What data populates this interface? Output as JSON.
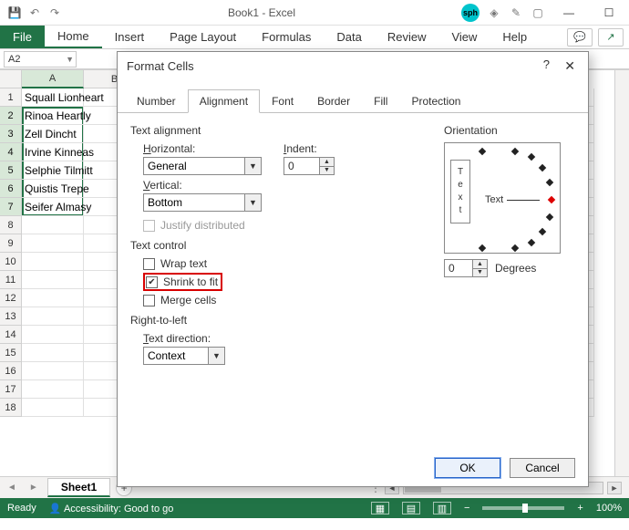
{
  "titlebar": {
    "title": "Book1 - Excel"
  },
  "ribbon": {
    "file": "File",
    "tabs": [
      "Home",
      "Insert",
      "Page Layout",
      "Formulas",
      "Data",
      "Review",
      "View",
      "Help"
    ]
  },
  "namebox": {
    "value": "A2"
  },
  "grid": {
    "col_headers": [
      "A",
      "B"
    ],
    "rows": [
      {
        "n": 1,
        "a": "Squall Lionheart"
      },
      {
        "n": 2,
        "a": "Rinoa Heartly"
      },
      {
        "n": 3,
        "a": "Zell Dincht"
      },
      {
        "n": 4,
        "a": "Irvine Kinneas"
      },
      {
        "n": 5,
        "a": "Selphie Tilmitt"
      },
      {
        "n": 6,
        "a": "Quistis Trepe"
      },
      {
        "n": 7,
        "a": "Seifer Almasy"
      },
      {
        "n": 8,
        "a": ""
      },
      {
        "n": 9,
        "a": ""
      },
      {
        "n": 10,
        "a": ""
      },
      {
        "n": 11,
        "a": ""
      },
      {
        "n": 12,
        "a": ""
      },
      {
        "n": 13,
        "a": ""
      },
      {
        "n": 14,
        "a": ""
      },
      {
        "n": 15,
        "a": ""
      },
      {
        "n": 16,
        "a": ""
      },
      {
        "n": 17,
        "a": ""
      },
      {
        "n": 18,
        "a": ""
      }
    ]
  },
  "sheets": {
    "active": "Sheet1"
  },
  "status": {
    "mode": "Ready",
    "accessibility": "Accessibility: Good to go",
    "zoom": "100%"
  },
  "dialog": {
    "title": "Format Cells",
    "tabs": [
      "Number",
      "Alignment",
      "Font",
      "Border",
      "Fill",
      "Protection"
    ],
    "active_tab": "Alignment",
    "sections": {
      "text_alignment": "Text alignment",
      "horizontal_label": "Horizontal:",
      "horizontal_value": "General",
      "vertical_label": "Vertical:",
      "vertical_value": "Bottom",
      "indent_label": "Indent:",
      "indent_value": "0",
      "justify_distributed": "Justify distributed",
      "text_control": "Text control",
      "wrap_text": "Wrap text",
      "shrink_to_fit": "Shrink to fit",
      "merge_cells": "Merge cells",
      "right_to_left": "Right-to-left",
      "text_direction_label": "Text direction:",
      "text_direction_value": "Context",
      "orientation": "Orientation",
      "orientation_text": "Text",
      "degrees_label": "Degrees",
      "degrees_value": "0"
    },
    "checked": {
      "wrap_text": false,
      "shrink_to_fit": true,
      "merge_cells": false,
      "justify_distributed": false
    },
    "buttons": {
      "ok": "OK",
      "cancel": "Cancel"
    }
  }
}
